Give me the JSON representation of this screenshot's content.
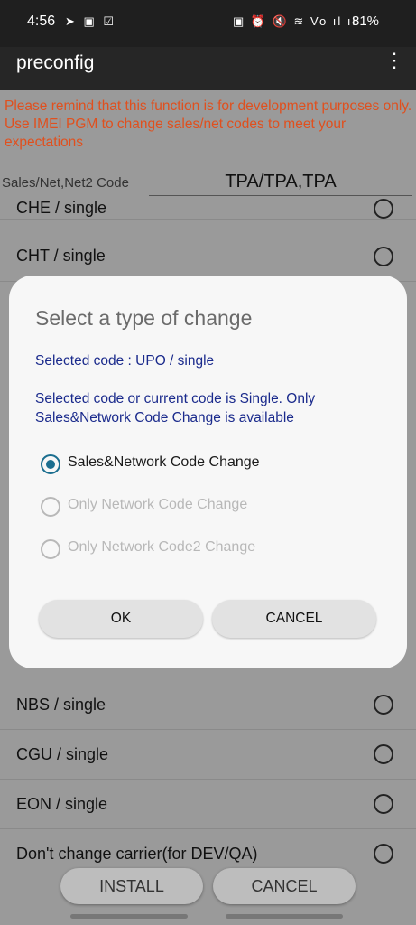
{
  "status": {
    "time": "4:56",
    "left_icons": "➤ ▣ ☑",
    "right_icons": "▣ ⏰ 🔇 ≋ Vo ıl ıl",
    "battery": "81%"
  },
  "appbar": {
    "title": "preconfig",
    "menu_icon": "more-vertical-icon"
  },
  "warning": "Please remind that this function is for development purposes only. Use IMEI PGM to change sales/net codes to meet your expectations",
  "code_row": {
    "label": "Sales/Net,Net2 Code",
    "value": "TPA/TPA,TPA"
  },
  "list": [
    {
      "label": "CHE / single"
    },
    {
      "label": "CHT / single"
    },
    {
      "label": "NBS / single"
    },
    {
      "label": "CGU / single"
    },
    {
      "label": "EON / single"
    },
    {
      "label": "Don't change carrier(for DEV/QA)"
    }
  ],
  "dialog": {
    "title": "Select a type of change",
    "selected_code": "Selected code : UPO / single",
    "note": "Selected code or current code is Single. Only Sales&Network Code Change is available",
    "options": [
      {
        "label": "Sales&Network Code Change",
        "checked": true,
        "enabled": true
      },
      {
        "label": "Only Network Code Change",
        "checked": false,
        "enabled": false
      },
      {
        "label": "Only Network Code2 Change",
        "checked": false,
        "enabled": false
      }
    ],
    "ok_label": "OK",
    "cancel_label": "CANCEL"
  },
  "bottom": {
    "install_label": "INSTALL",
    "cancel_label": "CANCEL"
  },
  "colors": {
    "warning": "#e0501e",
    "dialog_text": "#1a2a8c",
    "radio_accent": "#1b6e8f"
  }
}
